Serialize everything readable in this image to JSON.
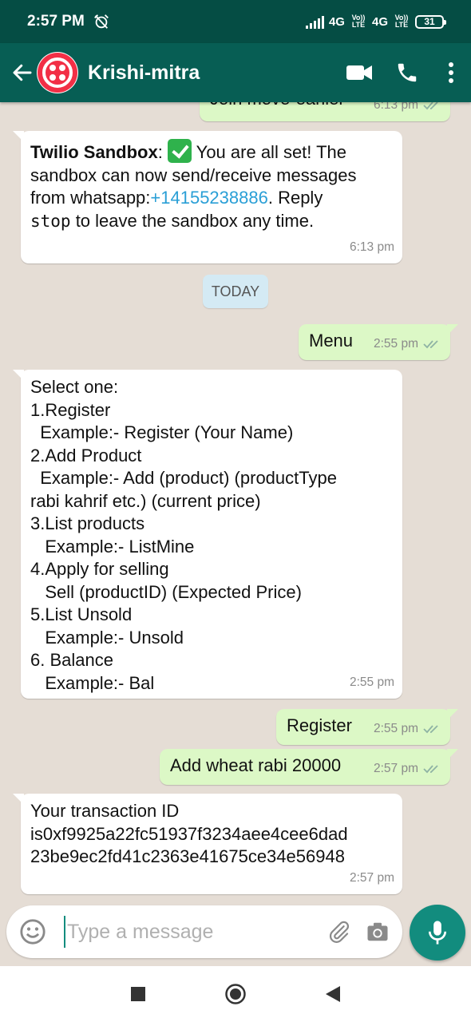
{
  "status_bar": {
    "time": "2:57 PM",
    "network_1": "4G",
    "network_2": "4G",
    "volte_1": "Vo)) LTE",
    "volte_2": "Vo)) LTE",
    "battery": "31"
  },
  "header": {
    "contact_name": "Krishi-mitra",
    "accent_color": "#075e54",
    "icons": [
      "back-arrow-icon",
      "twilio-logo-icon",
      "video-call-icon",
      "phone-icon",
      "more-vertical-icon"
    ]
  },
  "messages": [
    {
      "direction": "out",
      "lines": [
        "Join move-earlier"
      ],
      "time": "6:13 pm",
      "ticks": "read"
    },
    {
      "direction": "in",
      "sender": "Twilio Sandbox",
      "text_1": " You are all set! The",
      "line_2": "sandbox can now send/receive messages",
      "line_3_prefix": "from whatsapp:",
      "line_3_link": "+14155238886",
      "line_3_suffix": ". Reply",
      "line_4_code": "stop",
      "line_4_suffix": " to leave the sandbox any time.",
      "time": "6:13 pm"
    },
    {
      "direction": "out",
      "lines": [
        "Menu"
      ],
      "time": "2:55 pm",
      "ticks": "read"
    },
    {
      "direction": "in",
      "lines": [
        "Select one:",
        "1.Register",
        "  Example:- Register (Your Name)",
        "2.Add Product",
        "  Example:- Add (product) (productType",
        "rabi kahrif etc.) (current price)",
        "3.List products",
        "   Example:- ListMine",
        "4.Apply for selling",
        "   Sell (productID) (Expected Price)",
        "5.List Unsold",
        "   Example:- Unsold",
        "6. Balance",
        "   Example:- Bal"
      ],
      "time": "2:55 pm"
    },
    {
      "direction": "out",
      "lines": [
        "Register"
      ],
      "time": "2:55 pm",
      "ticks": "read"
    },
    {
      "direction": "out",
      "lines": [
        "Add wheat rabi 20000"
      ],
      "time": "2:57 pm",
      "ticks": "read"
    },
    {
      "direction": "in",
      "lines": [
        "Your transaction ID",
        "is0xf9925a22fc51937f3234aee4cee6dad",
        "23be9ec2fd41c2363e41675ce34e56948"
      ],
      "time": "2:57 pm"
    }
  ],
  "date_divider": "TODAY",
  "composer": {
    "placeholder": "Type a message",
    "value": ""
  },
  "colors": {
    "outgoing_bubble": "#dcf8c6",
    "incoming_bubble": "#ffffff",
    "chat_background": "#e5ddd5",
    "link": "#2a9fd6",
    "mic_button": "#128c7e"
  }
}
